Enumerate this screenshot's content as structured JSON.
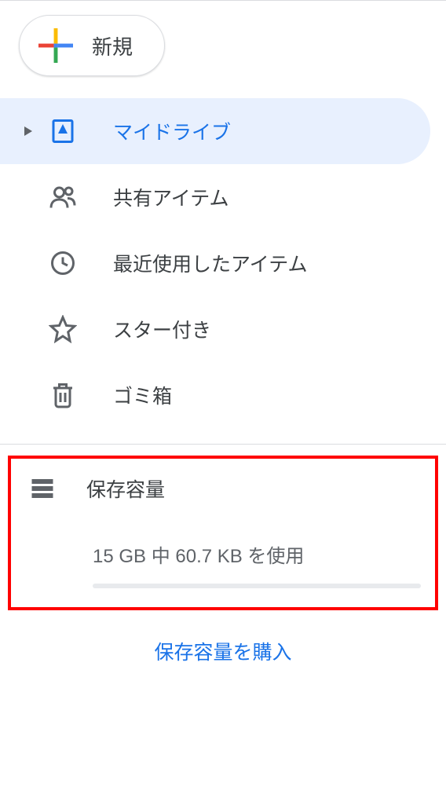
{
  "new_button": {
    "label": "新規"
  },
  "nav": {
    "items": [
      {
        "label": "マイドライブ",
        "active": true,
        "expandable": true
      },
      {
        "label": "共有アイテム"
      },
      {
        "label": "最近使用したアイテム"
      },
      {
        "label": "スター付き"
      },
      {
        "label": "ゴミ箱"
      }
    ]
  },
  "storage": {
    "label": "保存容量",
    "usage_text": "15 GB 中 60.7 KB を使用",
    "buy_link": "保存容量を購入"
  }
}
